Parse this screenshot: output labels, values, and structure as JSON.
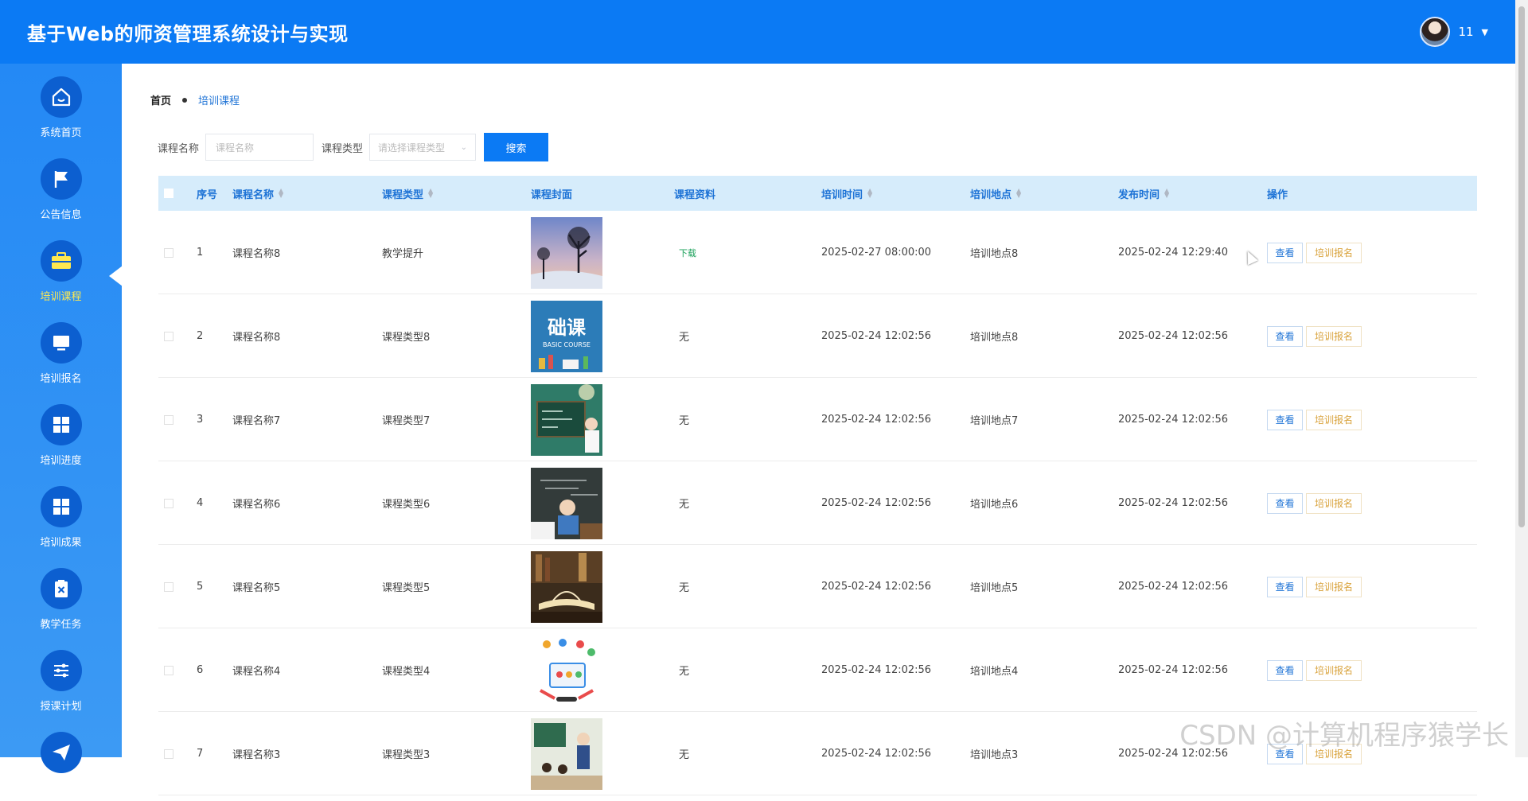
{
  "app": {
    "title": "基于Web的师资管理系统设计与实现"
  },
  "user": {
    "name": "11"
  },
  "sidebar": {
    "items": [
      {
        "label": "系统首页",
        "icon": "home-icon"
      },
      {
        "label": "公告信息",
        "icon": "flag-icon"
      },
      {
        "label": "培训课程",
        "icon": "briefcase-icon",
        "active": true
      },
      {
        "label": "培训报名",
        "icon": "monitor-icon"
      },
      {
        "label": "培训进度",
        "icon": "grid-icon"
      },
      {
        "label": "培训成果",
        "icon": "grid-icon"
      },
      {
        "label": "教学任务",
        "icon": "clipboard-icon"
      },
      {
        "label": "授课计划",
        "icon": "sliders-icon"
      }
    ]
  },
  "breadcrumb": {
    "home": "首页",
    "current": "培训课程"
  },
  "search": {
    "name_label": "课程名称",
    "name_placeholder": "课程名称",
    "type_label": "课程类型",
    "type_placeholder": "请选择课程类型",
    "button": "搜索"
  },
  "table": {
    "headers": {
      "index": "序号",
      "name": "课程名称",
      "type": "课程类型",
      "cover": "课程封面",
      "material": "课程资料",
      "time": "培训时间",
      "place": "培训地点",
      "publish": "发布时间",
      "ops": "操作"
    },
    "view_label": "查看",
    "enroll_label": "培训报名",
    "rows": [
      {
        "index": "1",
        "name": "课程名称8",
        "type": "教学提升",
        "material": "下载",
        "time": "2025-02-27 08:00:00",
        "place": "培训地点8",
        "publish": "2025-02-24 12:29:40"
      },
      {
        "index": "2",
        "name": "课程名称8",
        "type": "课程类型8",
        "material": "无",
        "time": "2025-02-24 12:02:56",
        "place": "培训地点8",
        "publish": "2025-02-24 12:02:56"
      },
      {
        "index": "3",
        "name": "课程名称7",
        "type": "课程类型7",
        "material": "无",
        "time": "2025-02-24 12:02:56",
        "place": "培训地点7",
        "publish": "2025-02-24 12:02:56"
      },
      {
        "index": "4",
        "name": "课程名称6",
        "type": "课程类型6",
        "material": "无",
        "time": "2025-02-24 12:02:56",
        "place": "培训地点6",
        "publish": "2025-02-24 12:02:56"
      },
      {
        "index": "5",
        "name": "课程名称5",
        "type": "课程类型5",
        "material": "无",
        "time": "2025-02-24 12:02:56",
        "place": "培训地点5",
        "publish": "2025-02-24 12:02:56"
      },
      {
        "index": "6",
        "name": "课程名称4",
        "type": "课程类型4",
        "material": "无",
        "time": "2025-02-24 12:02:56",
        "place": "培训地点4",
        "publish": "2025-02-24 12:02:56"
      },
      {
        "index": "7",
        "name": "课程名称3",
        "type": "课程类型3",
        "material": "无",
        "time": "2025-02-24 12:02:56",
        "place": "培训地点3",
        "publish": "2025-02-24 12:02:56"
      }
    ]
  },
  "covers": {
    "row2_text": "础课",
    "row2_sub": "BASIC COURSE"
  },
  "watermark": "CSDN @计算机程序猿学长",
  "colors": {
    "primary": "#0b7af4",
    "active_nav": "#ffe94f",
    "enroll": "#d9a33c",
    "download": "#1aa05a"
  }
}
